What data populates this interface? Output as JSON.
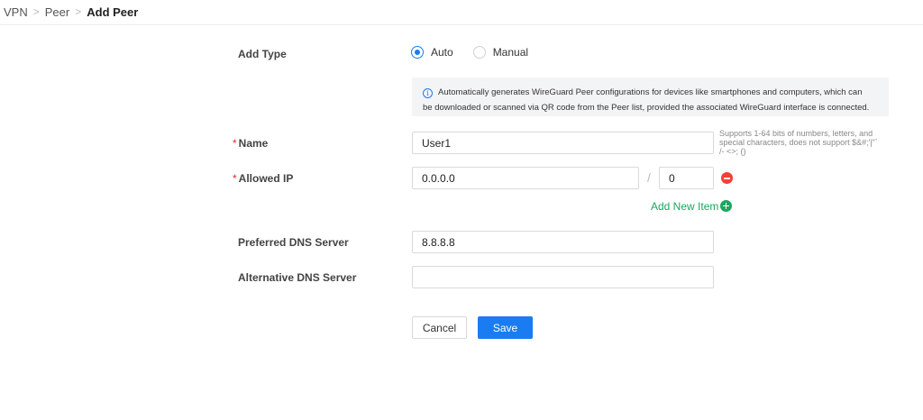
{
  "breadcrumb": {
    "items": [
      "VPN",
      "Peer"
    ],
    "current": "Add Peer",
    "separator": ">"
  },
  "form": {
    "add_type": {
      "label": "Add Type",
      "options": [
        {
          "label": "Auto",
          "selected": true
        },
        {
          "label": "Manual",
          "selected": false
        }
      ]
    },
    "info_text_line1": "Automatically generates WireGuard Peer configurations for devices like smartphones and computers, which can",
    "info_text_line2": "be downloaded or scanned via QR code from the Peer list, provided the associated WireGuard interface is connected.",
    "name": {
      "required_mark": "*",
      "label": "Name",
      "value": "User1",
      "hint": "Supports 1-64 bits of numbers, letters, and special characters, does not support $&#;'|\"` /- <>; ()"
    },
    "allowed_ip": {
      "required_mark": "*",
      "label": "Allowed IP",
      "ip_value": "0.0.0.0",
      "slash": "/",
      "mask_value": "0",
      "add_new_item": "Add New Item"
    },
    "preferred_dns": {
      "label": "Preferred DNS Server",
      "value": "8.8.8.8"
    },
    "alternative_dns": {
      "label": "Alternative DNS Server",
      "value": ""
    }
  },
  "buttons": {
    "cancel": "Cancel",
    "save": "Save"
  },
  "colors": {
    "primary": "#1a7cf0",
    "required": "#f5222d",
    "add_green": "#1aa760",
    "remove_red": "#f04134"
  }
}
